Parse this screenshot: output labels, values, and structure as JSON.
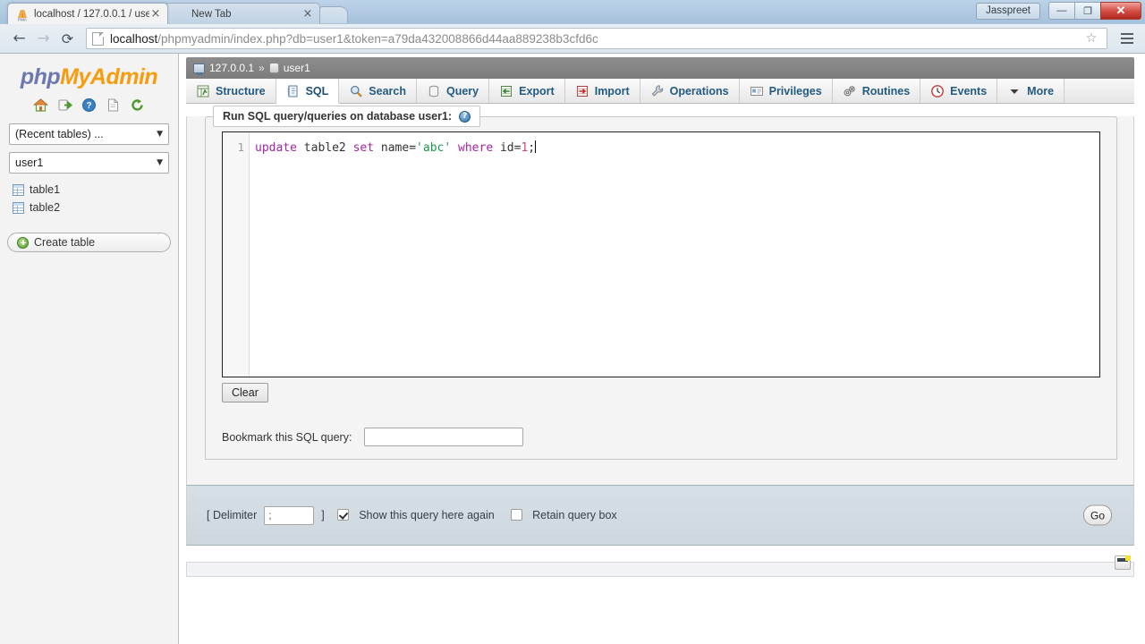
{
  "browser": {
    "tabs": [
      {
        "title": "localhost / 127.0.0.1 / use",
        "favicon": "phpmyadmin-favicon",
        "close": "×",
        "active": true
      },
      {
        "title": "New Tab",
        "favicon": "blank-favicon",
        "close": "×",
        "active": false
      }
    ],
    "new_tab_label": "",
    "user_chip": "Jasspreet",
    "window_controls": {
      "minimize": "—",
      "maximize": "❐",
      "close": "✕"
    },
    "nav": {
      "back": "←",
      "forward": "→",
      "reload": "⟳"
    },
    "url": {
      "host": "localhost",
      "path": "/phpmyadmin/index.php?db=user1&token=a79da432008866d44aa889238b3cfd6c",
      "full": "localhost/phpmyadmin/index.php?db=user1&token=a79da432008866d44aa889238b3cfd6c"
    },
    "star": "☆"
  },
  "sidebar": {
    "logo": {
      "php": "php",
      "my": "My",
      "admin": "Admin"
    },
    "icons": [
      {
        "name": "home-icon",
        "title": "Home"
      },
      {
        "name": "logout-icon",
        "title": "Log out"
      },
      {
        "name": "help-icon",
        "title": "phpMyAdmin documentation"
      },
      {
        "name": "docs-icon",
        "title": "Documentation"
      },
      {
        "name": "reload-icon",
        "title": "Reload navigation panel"
      }
    ],
    "recent_tables_select": "(Recent tables) ...",
    "database_select": "user1",
    "caret": "▼",
    "tables": [
      "table1",
      "table2"
    ],
    "create_table_label": "Create table"
  },
  "content": {
    "breadcrumb": {
      "server": "127.0.0.1",
      "separator": "»",
      "database": "user1"
    },
    "tabs": [
      {
        "label": "Structure",
        "icon": "structure-icon",
        "active": false
      },
      {
        "label": "SQL",
        "icon": "sql-icon",
        "active": true
      },
      {
        "label": "Search",
        "icon": "search-icon",
        "active": false
      },
      {
        "label": "Query",
        "icon": "query-icon",
        "active": false
      },
      {
        "label": "Export",
        "icon": "export-icon",
        "active": false
      },
      {
        "label": "Import",
        "icon": "import-icon",
        "active": false
      },
      {
        "label": "Operations",
        "icon": "operations-icon",
        "active": false
      },
      {
        "label": "Privileges",
        "icon": "privileges-icon",
        "active": false
      },
      {
        "label": "Routines",
        "icon": "routines-icon",
        "active": false
      },
      {
        "label": "Events",
        "icon": "events-icon",
        "active": false
      },
      {
        "label": "More",
        "icon": "chevron-down-icon",
        "active": false
      }
    ],
    "sql_legend": "Run SQL query/queries on database user1:",
    "sql_help": "?",
    "editor": {
      "line_number": "1",
      "tokens": [
        {
          "text": "update",
          "type": "keyword"
        },
        {
          "text": " ",
          "type": "plain"
        },
        {
          "text": "table2",
          "type": "identifier"
        },
        {
          "text": " ",
          "type": "plain"
        },
        {
          "text": "set",
          "type": "keyword"
        },
        {
          "text": " ",
          "type": "plain"
        },
        {
          "text": "name",
          "type": "identifier"
        },
        {
          "text": "=",
          "type": "operator"
        },
        {
          "text": "'abc'",
          "type": "string"
        },
        {
          "text": " ",
          "type": "plain"
        },
        {
          "text": "where",
          "type": "keyword"
        },
        {
          "text": " ",
          "type": "plain"
        },
        {
          "text": "id",
          "type": "identifier"
        },
        {
          "text": "=",
          "type": "operator"
        },
        {
          "text": "1",
          "type": "number"
        },
        {
          "text": ";",
          "type": "operator"
        }
      ],
      "plain_text": "update table2 set name='abc' where id=1;"
    },
    "clear_button": "Clear",
    "bookmark_label": "Bookmark this SQL query:",
    "bookmark_value": "",
    "bookmark_placeholder": "",
    "footer": {
      "delimiter_open": "[ Delimiter",
      "delimiter_value": ";",
      "delimiter_close": "]",
      "show_query_label": "Show this query here again",
      "show_query_checked": true,
      "retain_query_label": "Retain query box",
      "retain_query_checked": false,
      "go_button": "Go"
    },
    "console_icon_name": "console-icon"
  },
  "colors": {
    "accent_blue": "#235a81",
    "logo_orange": "#f89c0e",
    "logo_blue": "#6c78af",
    "keyword": "#a626a4",
    "string": "#1a9a4b",
    "number": "#d1417d",
    "footer_bg": "#d6dfe5"
  }
}
